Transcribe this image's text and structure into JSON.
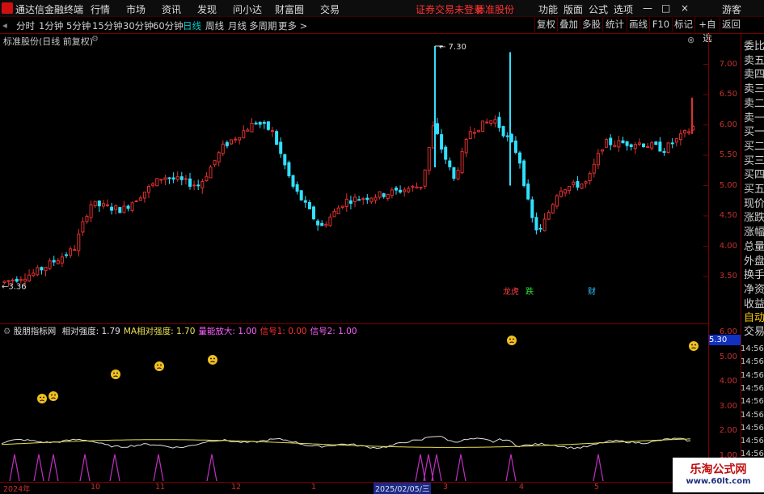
{
  "titlebar": {
    "app_title": "通达信金融终端",
    "menus": [
      "行情",
      "市场",
      "资讯",
      "发现",
      "问小达",
      "财富圈",
      "交易"
    ],
    "warning": "证券交易未登录",
    "stock_name": "标准股份",
    "right_menus": [
      "功能",
      "版面",
      "公式",
      "选项"
    ],
    "window_controls": [
      "—",
      "□",
      "×"
    ],
    "guest": "游客"
  },
  "periodbar": {
    "periods": [
      "分时",
      "1分钟",
      "5分钟",
      "15分钟",
      "30分钟",
      "60分钟",
      "日线",
      "周线",
      "月线",
      "多周期",
      "更多 >"
    ],
    "active": "日线",
    "tools": [
      "复权",
      "叠加",
      "多股",
      "统计",
      "画线",
      "F10",
      "标记",
      "+自选",
      "返回"
    ]
  },
  "main_chart": {
    "header": "标准股份(日线 前复权)",
    "y_ticks": [
      "7.00",
      "6.50",
      "6.00",
      "5.50",
      "5.00",
      "4.50",
      "4.00",
      "3.50"
    ],
    "high_label": "7.30",
    "low_label": "3.36",
    "event_markers": [
      "龙虎",
      "跌",
      "财"
    ]
  },
  "indicator": {
    "name": "股朋指标网",
    "items": [
      {
        "label": "相对强度: 1.79",
        "color": "#e0e0e0"
      },
      {
        "label": "MA相对强度: 1.70",
        "color": "#e8e050"
      },
      {
        "label": "量能放大: 1.00",
        "color": "#ff60ff"
      },
      {
        "label": "信号1: 0.00",
        "color": "#ff3030"
      },
      {
        "label": "信号2: 1.00",
        "color": "#ff60ff"
      }
    ],
    "y_ticks": [
      "6.00",
      "5.00",
      "4.00",
      "3.00",
      "2.00",
      "1.00"
    ],
    "current_value": "5.30"
  },
  "right_panel": {
    "labels": [
      "委比",
      "卖五",
      "卖四",
      "卖三",
      "卖二",
      "卖一",
      "买一",
      "买二",
      "买三",
      "买四",
      "买五",
      "现价",
      "涨跌",
      "涨幅",
      "总量",
      "外盘",
      "换手",
      "净资",
      "收益",
      "自动",
      "交易"
    ]
  },
  "time_labels": [
    "14:56",
    "14:56",
    "14:56",
    "14:56",
    "14:56",
    "14:56",
    "14:56",
    "14:56",
    "14:56",
    "14:56",
    "14:56"
  ],
  "bottom_axis": {
    "labels": [
      "2024年",
      "10",
      "11",
      "12",
      "1",
      "2025/02/05/三",
      "3",
      "4",
      "5"
    ]
  },
  "watermark": {
    "line1": "乐淘公式网",
    "line2": "www.60lt.com"
  },
  "colors": {
    "up": "#e03030",
    "down": "#30e0ff",
    "axis": "#c83030",
    "frame": "#7a0000"
  }
}
